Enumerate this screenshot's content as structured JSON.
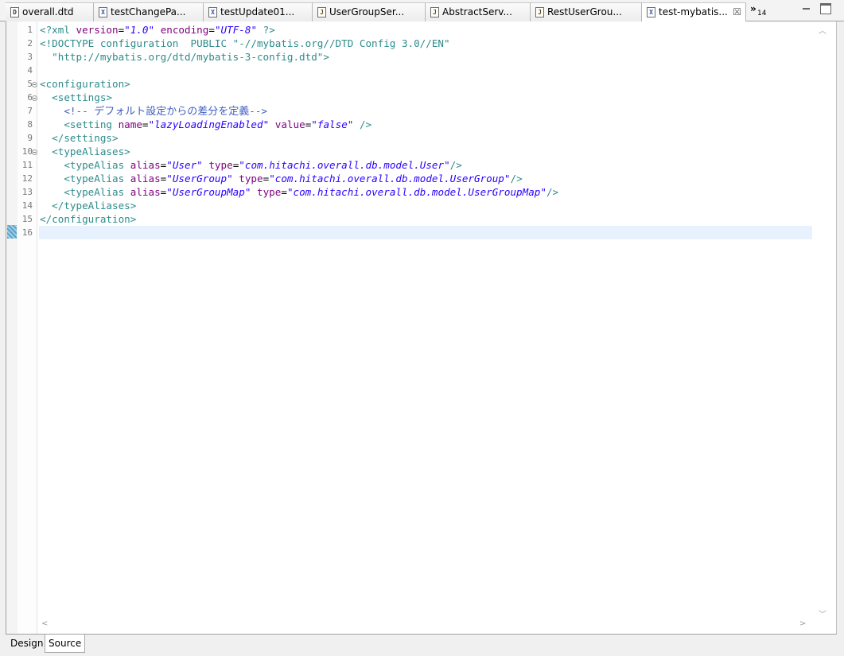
{
  "tabs": [
    {
      "label": "overall.dtd",
      "icon": "D",
      "icon_name": "dtd-file-icon",
      "active": false
    },
    {
      "label": "testChangePa...",
      "icon": "X",
      "icon_name": "xml-file-icon",
      "active": false
    },
    {
      "label": "testUpdate01...",
      "icon": "X",
      "icon_name": "xml-file-icon",
      "active": false
    },
    {
      "label": "UserGroupSer...",
      "icon": "J",
      "icon_name": "java-file-icon",
      "active": false
    },
    {
      "label": "AbstractServ...",
      "icon": "J",
      "icon_name": "java-file-icon",
      "active": false
    },
    {
      "label": "RestUserGrou...",
      "icon": "J",
      "icon_name": "java-file-icon",
      "active": false
    },
    {
      "label": "test-mybatis...",
      "icon": "X",
      "icon_name": "xml-file-icon",
      "active": true,
      "close": "☒"
    }
  ],
  "overflow": {
    "chevron": "»",
    "count": "14"
  },
  "editor": {
    "line_numbers": [
      "1",
      "2",
      "3",
      "4",
      "5",
      "6",
      "7",
      "8",
      "9",
      "10",
      "11",
      "12",
      "13",
      "14",
      "15",
      "16"
    ],
    "code": {
      "l1": {
        "a": "<?xml ",
        "b": "version",
        "c": "=",
        "d": "\"1.0\"",
        "e": " ",
        "f": "encoding",
        "g": "=",
        "h": "\"UTF-8\"",
        "i": " ?>"
      },
      "l2": {
        "a": "<!DOCTYPE configuration  PUBLIC ",
        "b": "\"-//mybatis.org//DTD Config 3.0//EN\""
      },
      "l3": {
        "a": "  \"http://mybatis.org/dtd/mybatis-3-config.dtd\">"
      },
      "l5": {
        "a": "<configuration>"
      },
      "l6": {
        "a": "  <settings>"
      },
      "l7": {
        "a": "    <!-- ",
        "b": "デフォルト設定からの差分を定義",
        "c": "-->"
      },
      "l8": {
        "a": "    <setting ",
        "b": "name",
        "c": "=",
        "d": "\"lazyLoadingEnabled\"",
        "e": " ",
        "f": "value",
        "g": "=",
        "h": "\"false\"",
        "i": " />"
      },
      "l9": {
        "a": "  </settings>"
      },
      "l10": {
        "a": "  <typeAliases>"
      },
      "l11": {
        "a": "    <typeAlias ",
        "b": "alias",
        "c": "=",
        "d": "\"User\"",
        "e": " ",
        "f": "type",
        "g": "=",
        "h": "\"com.hitachi.overall.db.model.User\"",
        "i": "/>"
      },
      "l12": {
        "a": "    <typeAlias ",
        "b": "alias",
        "c": "=",
        "d": "\"UserGroup\"",
        "e": " ",
        "f": "type",
        "g": "=",
        "h": "\"com.hitachi.overall.db.model.UserGroup\"",
        "i": "/>"
      },
      "l13": {
        "a": "    <typeAlias ",
        "b": "alias",
        "c": "=",
        "d": "\"UserGroupMap\"",
        "e": " ",
        "f": "type",
        "g": "=",
        "h": "\"com.hitachi.overall.db.model.UserGroupMap\"",
        "i": "/>"
      },
      "l14": {
        "a": "  </typeAliases>"
      },
      "l15": {
        "a": "</configuration>"
      }
    }
  },
  "bottom_tabs": {
    "design": "Design",
    "source": "Source"
  },
  "scroll_glyphs": {
    "up": "︿",
    "down": "﹀",
    "left": "<",
    "right": ">"
  }
}
